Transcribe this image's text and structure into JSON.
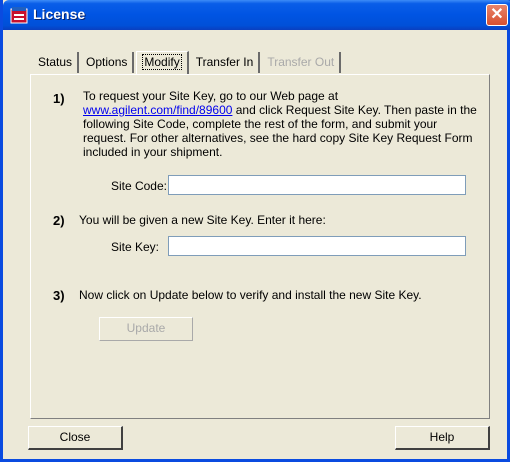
{
  "window": {
    "title": "License",
    "close_glyph": "✕"
  },
  "tabs": [
    {
      "label": "Status"
    },
    {
      "label": "Options"
    },
    {
      "label": "Modify"
    },
    {
      "label": "Transfer In"
    },
    {
      "label": "Transfer Out"
    }
  ],
  "steps": {
    "step1": {
      "number": "1)",
      "text_before_link": "To request your Site Key, go to our Web page at",
      "link": "www.agilent.com/find/89600",
      "text_after_link": " and click Request Site Key. Then paste in the following Site Code, complete the rest of the form, and submit your request. For other alternatives, see the hard copy Site Key Request Form included in your shipment."
    },
    "site_code": {
      "label": "Site Code:",
      "value": ""
    },
    "step2": {
      "number": "2)",
      "text": "You will be given a new Site Key.  Enter it here:"
    },
    "site_key": {
      "label": "Site Key:",
      "value": ""
    },
    "step3": {
      "number": "3)",
      "text": "Now click on Update below to verify and install the new Site Key."
    }
  },
  "buttons": {
    "update": "Update",
    "close": "Close",
    "help": "Help"
  }
}
